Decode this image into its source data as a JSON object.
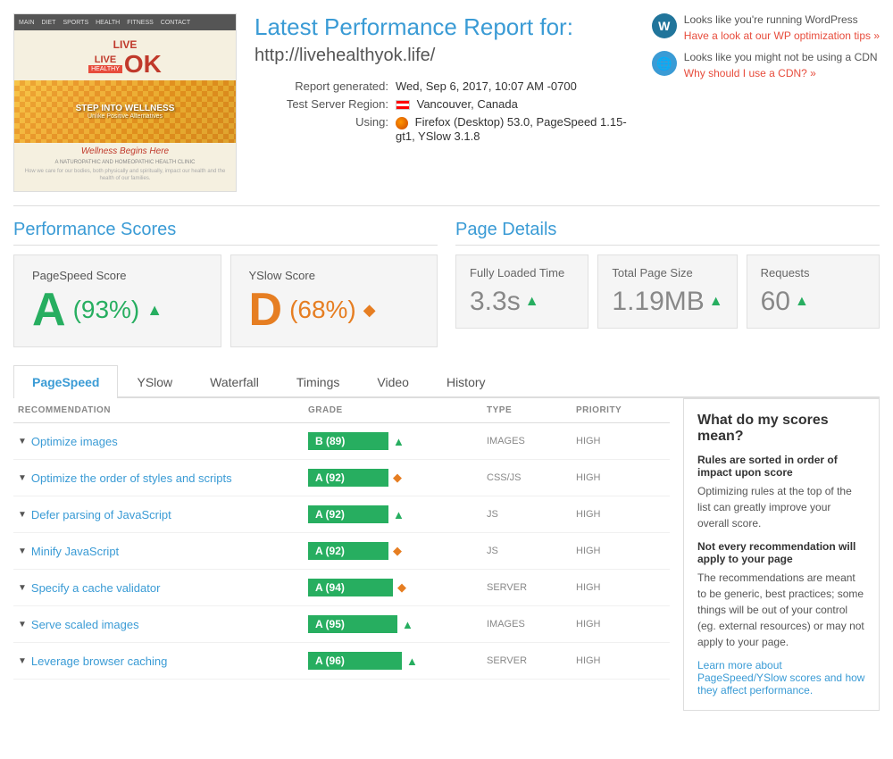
{
  "header": {
    "title": "Latest Performance Report for:",
    "url": "http://livehealthyok.life/",
    "report_generated_label": "Report generated:",
    "report_generated_value": "Wed, Sep 6, 2017, 10:07 AM -0700",
    "test_server_label": "Test Server Region:",
    "test_server_value": "Vancouver, Canada",
    "using_label": "Using:",
    "using_value": "Firefox (Desktop) 53.0, PageSpeed 1.15-gt1, YSlow 3.1.8",
    "notice1_text": "Looks like you're running WordPress",
    "notice1_link": "Have a look at our WP optimization tips »",
    "notice2_text": "Looks like you might not be using a CDN",
    "notice2_link": "Why should I use a CDN? »"
  },
  "performance_scores": {
    "title": "Performance Scores",
    "pagespeed_label": "PageSpeed Score",
    "pagespeed_grade": "A",
    "pagespeed_pct": "(93%)",
    "yslow_label": "YSlow Score",
    "yslow_grade": "D",
    "yslow_pct": "(68%)"
  },
  "page_details": {
    "title": "Page Details",
    "loaded_label": "Fully Loaded Time",
    "loaded_value": "3.3s",
    "size_label": "Total Page Size",
    "size_value": "1.19MB",
    "requests_label": "Requests",
    "requests_value": "60"
  },
  "tabs": [
    {
      "id": "pagespeed",
      "label": "PageSpeed",
      "active": true
    },
    {
      "id": "yslow",
      "label": "YSlow",
      "active": false
    },
    {
      "id": "waterfall",
      "label": "Waterfall",
      "active": false
    },
    {
      "id": "timings",
      "label": "Timings",
      "active": false
    },
    {
      "id": "video",
      "label": "Video",
      "active": false
    },
    {
      "id": "history",
      "label": "History",
      "active": false
    }
  ],
  "table": {
    "columns": [
      "RECOMMENDATION",
      "GRADE",
      "TYPE",
      "PRIORITY"
    ],
    "rows": [
      {
        "name": "Optimize images",
        "grade": "B (89)",
        "icon": "arrow",
        "type": "IMAGES",
        "priority": "HIGH"
      },
      {
        "name": "Optimize the order of styles and scripts",
        "grade": "A (92)",
        "icon": "diamond",
        "type": "CSS/JS",
        "priority": "HIGH"
      },
      {
        "name": "Defer parsing of JavaScript",
        "grade": "A (92)",
        "icon": "arrow",
        "type": "JS",
        "priority": "HIGH"
      },
      {
        "name": "Minify JavaScript",
        "grade": "A (92)",
        "icon": "diamond",
        "type": "JS",
        "priority": "HIGH"
      },
      {
        "name": "Specify a cache validator",
        "grade": "A (94)",
        "icon": "diamond",
        "type": "SERVER",
        "priority": "HIGH"
      },
      {
        "name": "Serve scaled images",
        "grade": "A (95)",
        "icon": "arrow",
        "type": "IMAGES",
        "priority": "HIGH"
      },
      {
        "name": "Leverage browser caching",
        "grade": "A (96)",
        "icon": "arrow",
        "type": "SERVER",
        "priority": "HIGH"
      }
    ]
  },
  "info_box": {
    "title": "What do my scores mean?",
    "subtitle1": "Rules are sorted in order of impact upon score",
    "text1": "Optimizing rules at the top of the list can greatly improve your overall score.",
    "subtitle2": "Not every recommendation will apply to your page",
    "text2": "The recommendations are meant to be generic, best practices; some things will be out of your control (eg. external resources) or may not apply to your page.",
    "link_text": "Learn more about PageSpeed/YSlow scores and how they affect performance."
  },
  "thumbnail": {
    "nav_items": [
      "MAIN",
      "DIET",
      "SPORTS",
      "HEALTH",
      "FITNESS",
      "CONTACT"
    ],
    "logo_live": "LIVE",
    "logo_healthy": "HEALTHY",
    "logo_ok": "OK",
    "step_text": "STEP INTO WELLNESS",
    "tagline": "Unlike Positive Alternatives",
    "wellness": "Wellness Begins Here",
    "subtitle": "A NATUROPATHIC AND HOMEOPATHIC HEALTH CLINIC",
    "body_text": "How we care for our bodies, both physically and spiritually, impact our health and the health of our families."
  }
}
